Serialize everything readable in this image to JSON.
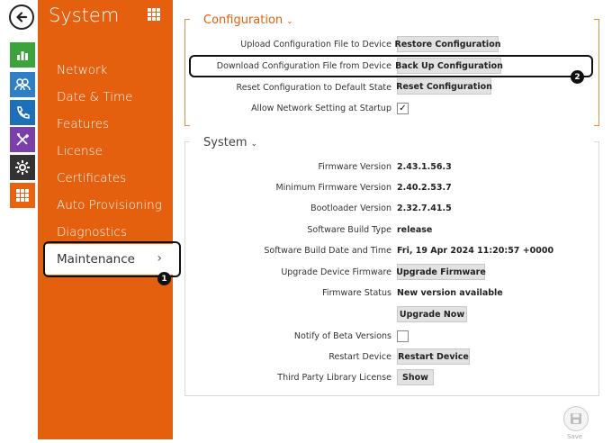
{
  "rail": {
    "icons": [
      "back-arrow-icon",
      "status-chart-icon",
      "directory-icon",
      "phone-icon",
      "hardware-tools-icon",
      "settings-gear-icon",
      "system-grid-icon"
    ]
  },
  "sidebar": {
    "title": "System",
    "items": [
      {
        "label": "Network"
      },
      {
        "label": "Date & Time"
      },
      {
        "label": "Features"
      },
      {
        "label": "License"
      },
      {
        "label": "Certificates"
      },
      {
        "label": "Auto Provisioning"
      },
      {
        "label": "Diagnostics"
      },
      {
        "label": "Maintenance",
        "active": true
      }
    ],
    "active_chevron": "›"
  },
  "callouts": {
    "one": "1",
    "two": "2"
  },
  "configuration": {
    "title": "Configuration",
    "rows": [
      {
        "label": "Upload Configuration File to Device",
        "button": "Restore Configuration"
      },
      {
        "label": "Download Configuration File from Device",
        "button": "Back Up Configuration"
      },
      {
        "label": "Reset Configuration to Default State",
        "button": "Reset Configuration"
      },
      {
        "label": "Allow Network Setting at Startup",
        "checked": true
      }
    ]
  },
  "system": {
    "title": "System",
    "firmware_version_label": "Firmware Version",
    "firmware_version": "2.43.1.56.3",
    "min_firmware_label": "Minimum Firmware Version",
    "min_firmware": "2.40.2.53.7",
    "bootloader_label": "Bootloader Version",
    "bootloader": "2.32.7.41.5",
    "build_type_label": "Software Build Type",
    "build_type": "release",
    "build_date_label": "Software Build Date and Time",
    "build_date": "Fri, 19 Apr 2024 11:20:57 +0000",
    "upgrade_label": "Upgrade Device Firmware",
    "upgrade_button": "Upgrade Firmware",
    "status_label": "Firmware Status",
    "status": "New version available",
    "upgrade_now_button": "Upgrade Now",
    "beta_label": "Notify of Beta Versions",
    "beta_checked": false,
    "restart_label": "Restart Device",
    "restart_button": "Restart Device",
    "third_party_label": "Third Party Library License",
    "show_button": "Show"
  },
  "footer": {
    "save_label": "Save"
  },
  "colors": {
    "accent": "#e45f0e",
    "sidebar_bg": "#e45f0e",
    "button_bg": "#e2e2e2"
  }
}
